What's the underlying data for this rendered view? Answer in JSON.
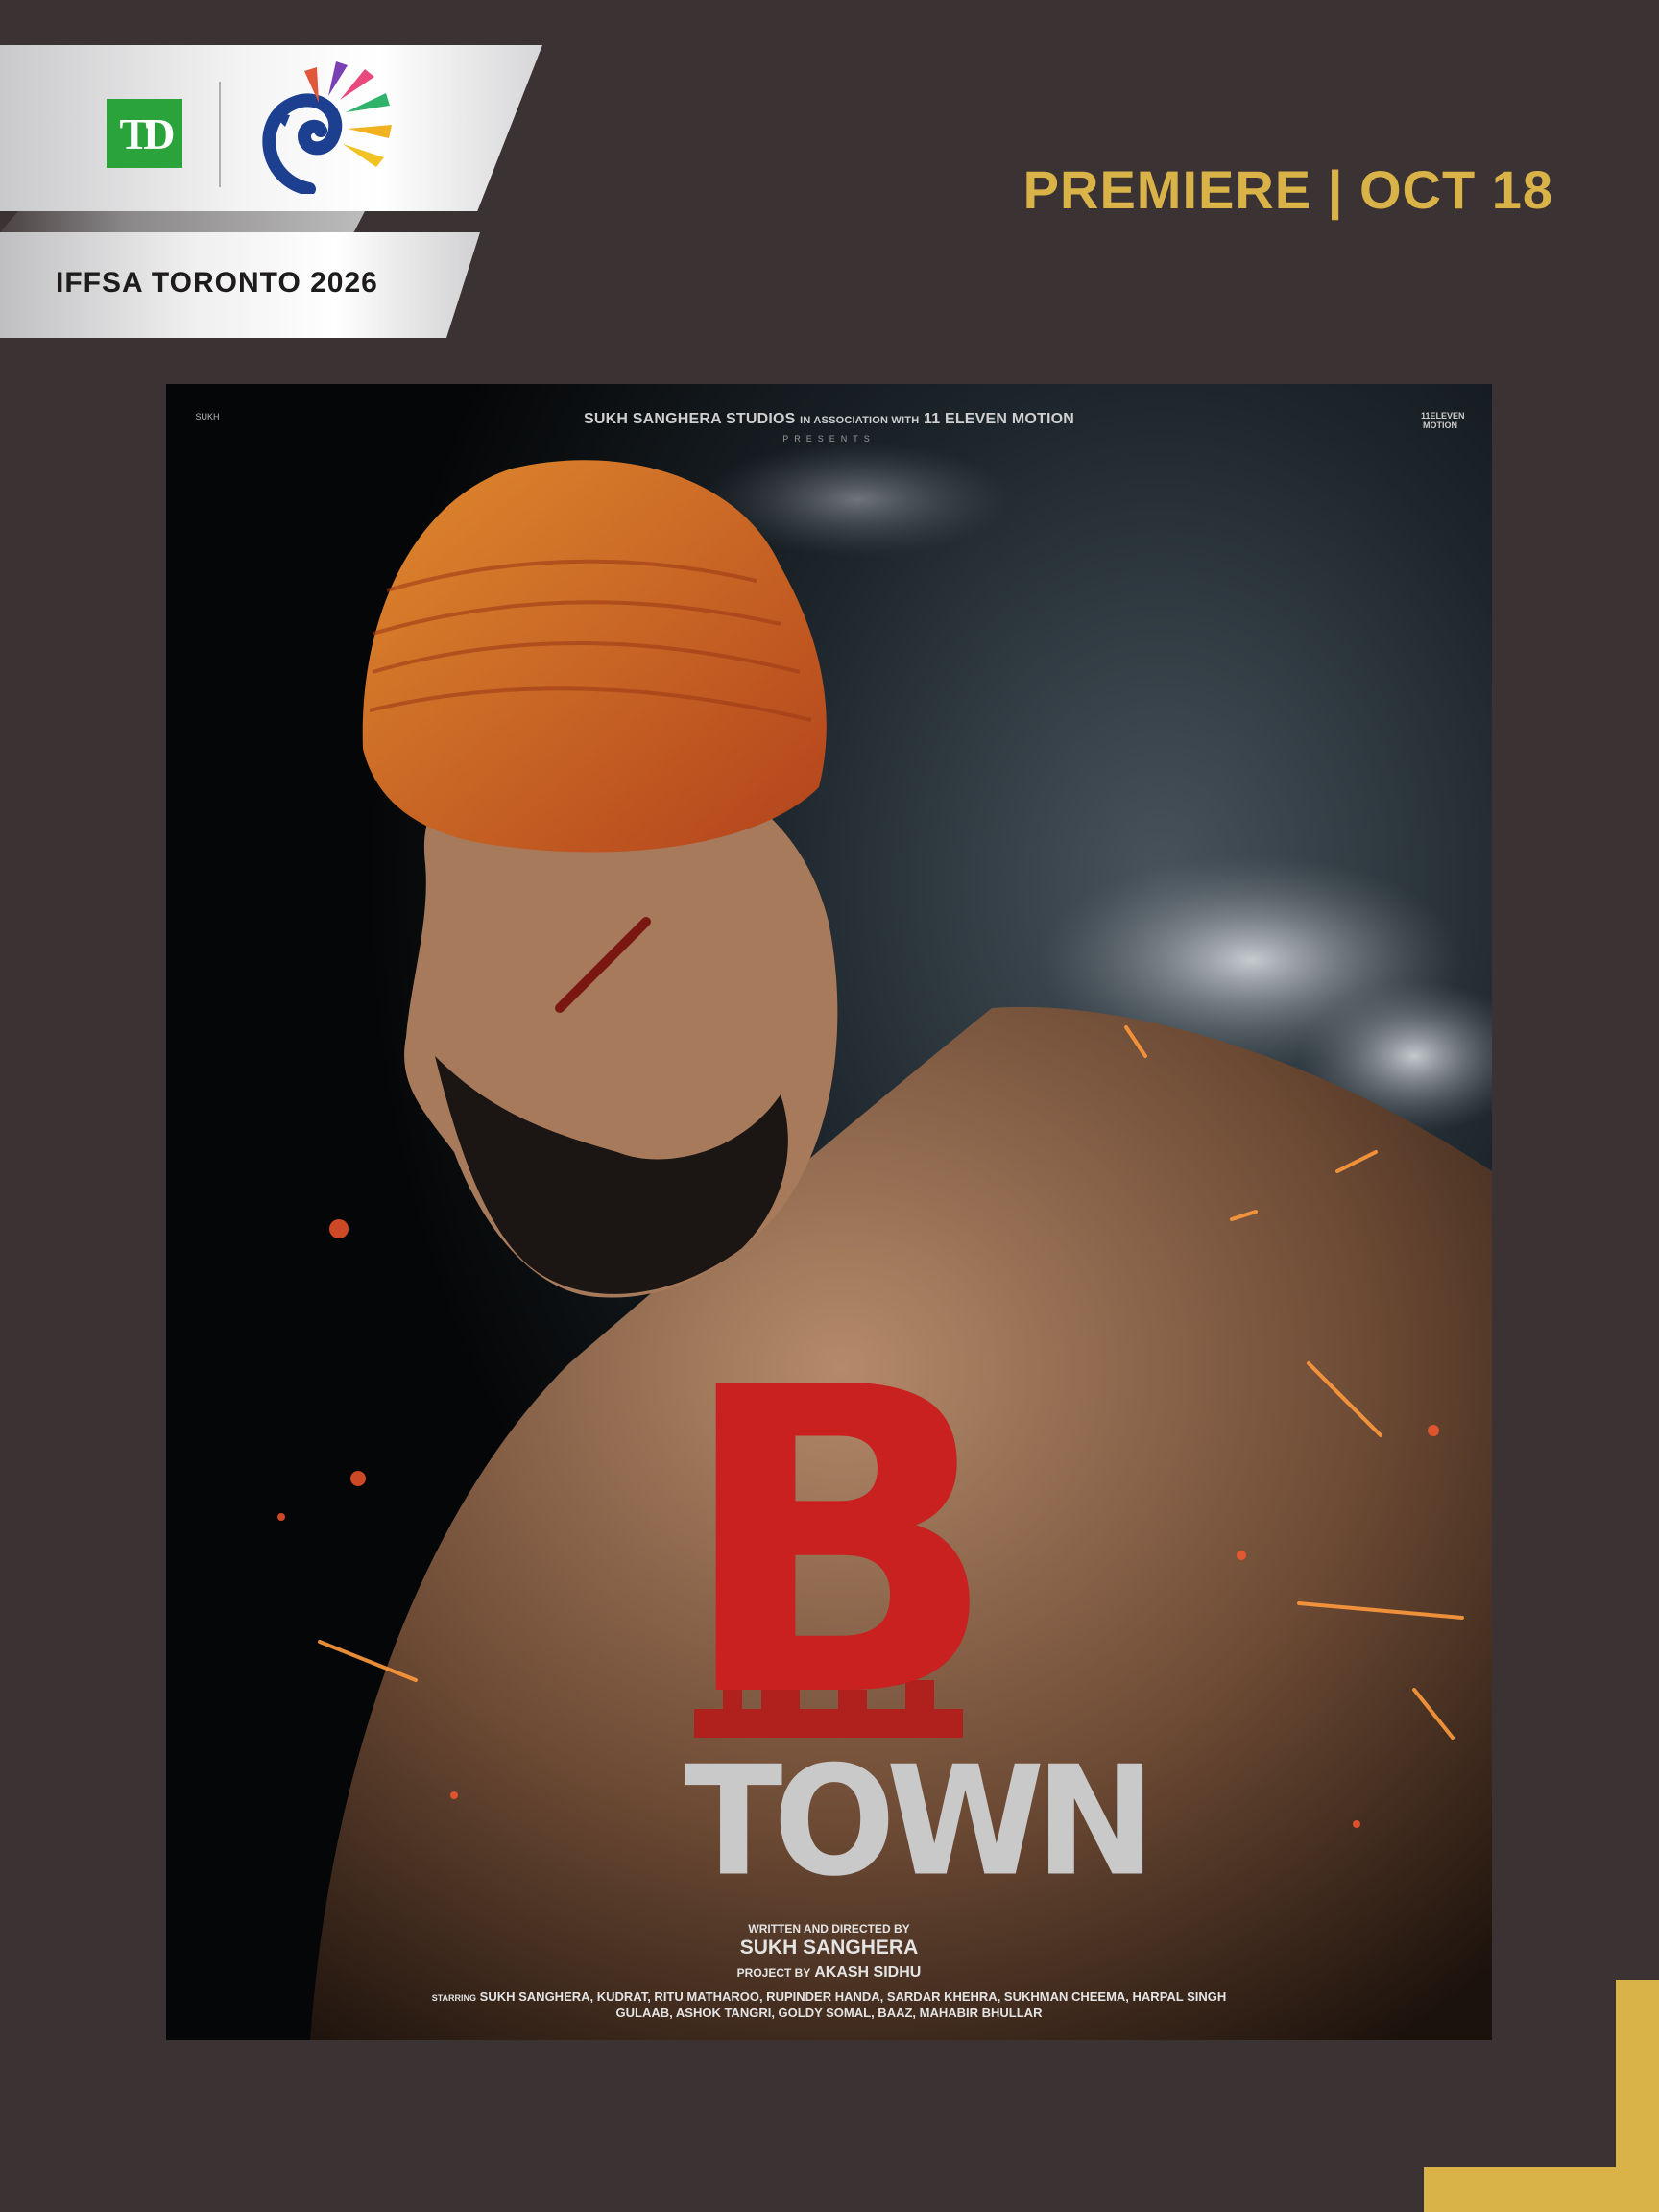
{
  "header": {
    "festival_label": "IFFSA TORONTO 2026",
    "sponsor_logo_text": "TD",
    "premiere_text": "PREMIERE | OCT 18"
  },
  "poster": {
    "presents_line_a": "SUKH SANGHERA STUDIOS",
    "presents_line_b": "IN ASSOCIATION WITH",
    "presents_line_c": "11 ELEVEN MOTION",
    "presents": "PRESENTS",
    "corner_left": "SUKH",
    "corner_right": "11ELEVEN MOTION",
    "title_big": "B",
    "title_sub": "TOWN",
    "written_directed_label": "WRITTEN AND DIRECTED BY",
    "director": "SUKH SANGHERA",
    "project_by_label": "PROJECT BY",
    "project_by": "AKASH SIDHU",
    "starring_label": "STARRING",
    "cast_line1": "SUKH SANGHERA, KUDRAT, RITU MATHAROO, RUPINDER HANDA, SARDAR KHEHRA, SUKHMAN CHEEMA, HARPAL SINGH",
    "cast_line2": "GULAAB, ASHOK TANGRI, GOLDY SOMAL, BAAZ, MAHABIR BHULLAR"
  },
  "colors": {
    "background": "#3b3233",
    "accent_gold": "#d9b248",
    "td_green": "#2aa33a",
    "title_red": "#c8211f"
  }
}
